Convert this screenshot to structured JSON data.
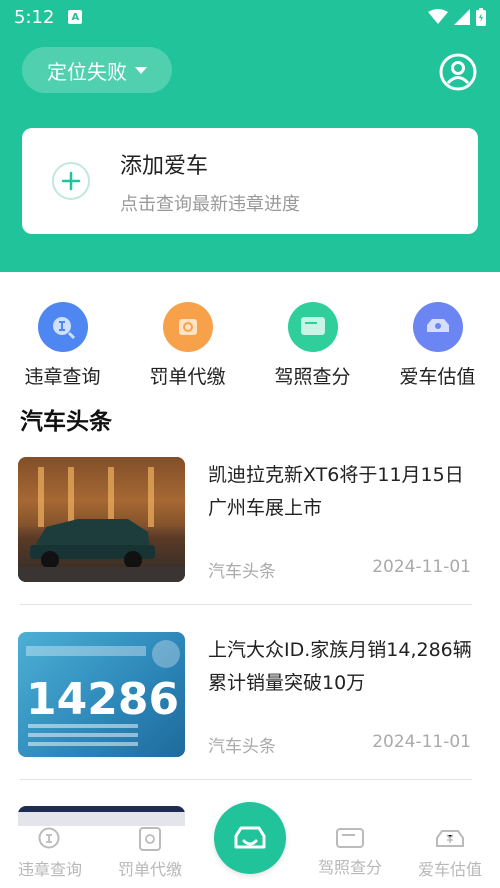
{
  "status_bar": {
    "time": "5:12",
    "notif_letter": "A"
  },
  "header": {
    "location_label": "定位失败"
  },
  "add_car": {
    "title": "添加爱车",
    "subtitle": "点击查询最新违章进度"
  },
  "quick_actions": [
    {
      "label": "违章查询",
      "icon": "violation-search-icon",
      "color": "#4e86f2"
    },
    {
      "label": "罚单代缴",
      "icon": "ticket-pay-icon",
      "color": "#f7a24a"
    },
    {
      "label": "驾照查分",
      "icon": "license-score-icon",
      "color": "#2fcf9b"
    },
    {
      "label": "爱车估值",
      "icon": "car-valuation-icon",
      "color": "#6b86f3"
    }
  ],
  "section_title": "汽车头条",
  "news": [
    {
      "title": "凯迪拉克新XT6将于11月15日广州车展上市",
      "source": "汽车头条",
      "date": "2024-11-01",
      "thumb_text": ""
    },
    {
      "title": "上汽大众ID.家族月销14,286辆 累计销量突破10万",
      "source": "汽车头条",
      "date": "2024-11-01",
      "thumb_text": "14286"
    }
  ],
  "bottom_nav": [
    {
      "label": "违章查询",
      "icon": "violation-tab-icon"
    },
    {
      "label": "罚单代缴",
      "icon": "ticket-tab-icon"
    },
    {
      "label": "",
      "icon": "car-center-icon"
    },
    {
      "label": "驾照查分",
      "icon": "license-tab-icon"
    },
    {
      "label": "爱车估值",
      "icon": "valuation-tab-icon"
    }
  ],
  "colors": {
    "brand": "#20c39a",
    "text_muted": "#999999"
  }
}
